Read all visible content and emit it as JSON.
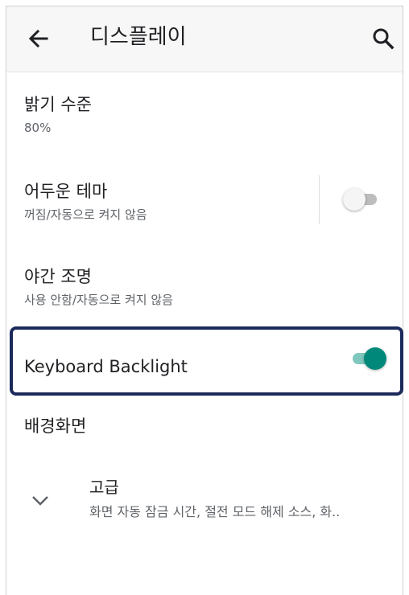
{
  "appbar": {
    "title": "디스플레이",
    "back_icon": "arrow-left-icon",
    "search_icon": "search-icon"
  },
  "settings": {
    "brightness": {
      "title": "밝기 수준",
      "summary": "80%"
    },
    "dark_theme": {
      "title": "어두운 테마",
      "summary": "꺼짐/자동으로 켜지 않음",
      "enabled": false
    },
    "night_light": {
      "title": "야간 조명",
      "summary": "사용 안함/자동으로 켜지 않음"
    },
    "keyboard_backlight": {
      "title": "Keyboard Backlight",
      "enabled": true
    },
    "wallpaper": {
      "title": "배경화면"
    },
    "advanced": {
      "title": "고급",
      "summary": "화면 자동 잠금 시간, 절전 모드 해제 소스, 화..",
      "icon": "chevron-down-icon"
    }
  },
  "colors": {
    "accent": "#00897b",
    "accent_track": "#80c7bd",
    "highlight_border": "#1b2a5a"
  }
}
